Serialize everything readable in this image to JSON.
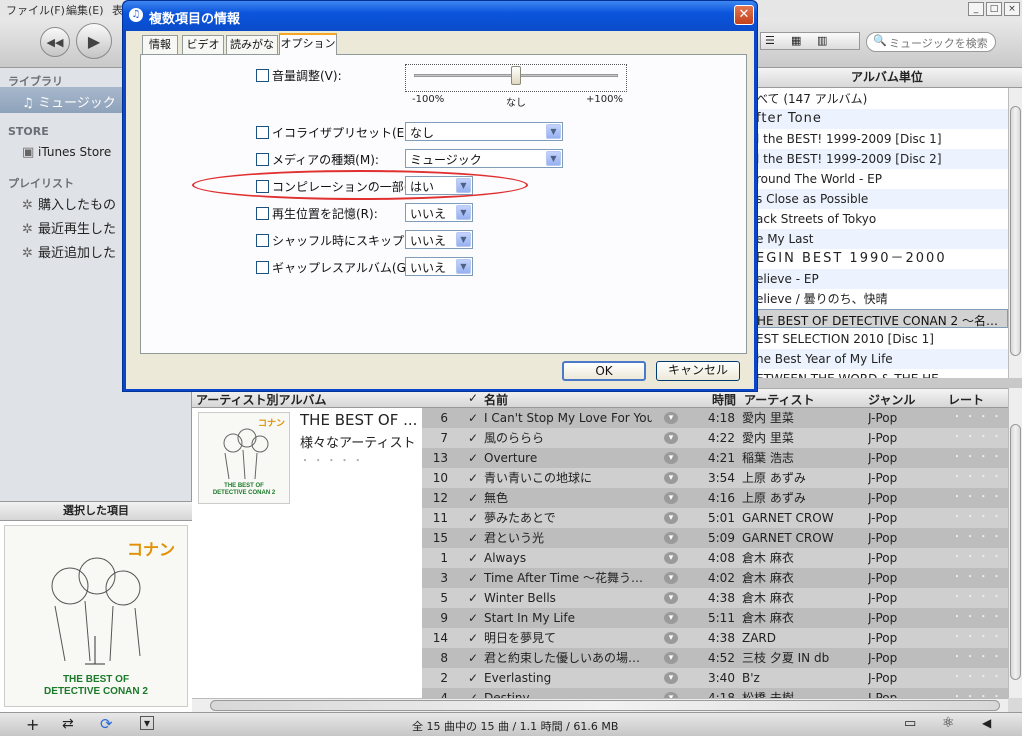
{
  "menu": {
    "file": "ファイル(F)",
    "edit": "編集(E)",
    "more": "表"
  },
  "search": {
    "placeholder": "ミュージックを検索"
  },
  "sidebar": {
    "library_header": "ライブラリ",
    "music": "ミュージック",
    "store_header": "STORE",
    "itunes_store": "iTunes Store",
    "playlist_header": "プレイリスト",
    "playlists": [
      "購入したもの",
      "最近再生した",
      "最近追加した"
    ],
    "selected_header": "選択した項目"
  },
  "cover": {
    "logo": "コナン",
    "line1": "THE BEST OF",
    "line2": "DETECTIVE CONAN 2"
  },
  "album_pane": {
    "header": "アルバム単位",
    "items": [
      "べて (147 アルバム)",
      "fter  Tone",
      "l the BEST! 1999-2009 [Disc 1]",
      "l the BEST! 1999-2009 [Disc 2]",
      "round The World - EP",
      "s Close as Possible",
      "ack Streets of Tokyo",
      "e My Last",
      "EGIN  BEST  1990－2000",
      "elieve - EP",
      "elieve / 曇りのち、快晴",
      "HE BEST OF DETECTIVE CONAN 2 ～名…",
      "EST SELECTION 2010 [Disc 1]",
      "he Best Year of My Life",
      "ETWEEN THE WORD & THE HE"
    ]
  },
  "list": {
    "headers": {
      "artist_album": "アーティスト別アルバム",
      "check": "✓",
      "name": "名前",
      "time": "時間",
      "artist": "アーティスト",
      "genre": "ジャンル",
      "rating": "レート"
    },
    "album_title": "THE BEST OF ...",
    "album_artist": "様々なアーティスト",
    "album_rating": "・ ・ ・ ・ ・",
    "rows": [
      {
        "num": "6",
        "name": "I Can't Stop My Love For You",
        "time": "4:18",
        "artist": "愛内 里菜",
        "genre": "J-Pop",
        "rating": "・ ・ ・ ・ ・"
      },
      {
        "num": "7",
        "name": "風のららら",
        "time": "4:22",
        "artist": "愛内 里菜",
        "genre": "J-Pop",
        "rating": "・ ・ ・ ・ ・"
      },
      {
        "num": "13",
        "name": "Overture",
        "time": "4:21",
        "artist": "稲葉 浩志",
        "genre": "J-Pop",
        "rating": "・ ・ ・ ・ ・"
      },
      {
        "num": "10",
        "name": "青い青いこの地球に",
        "time": "3:54",
        "artist": "上原 あずみ",
        "genre": "J-Pop",
        "rating": "・ ・ ・ ・ ・"
      },
      {
        "num": "12",
        "name": "無色",
        "time": "4:16",
        "artist": "上原 あずみ",
        "genre": "J-Pop",
        "rating": "・ ・ ・ ・ ・"
      },
      {
        "num": "11",
        "name": "夢みたあとで",
        "time": "5:01",
        "artist": "GARNET CROW",
        "genre": "J-Pop",
        "rating": "・ ・ ・ ・ ・"
      },
      {
        "num": "15",
        "name": "君という光",
        "time": "5:09",
        "artist": "GARNET CROW",
        "genre": "J-Pop",
        "rating": "・ ・ ・ ・ ・"
      },
      {
        "num": "1",
        "name": "Always",
        "time": "4:08",
        "artist": "倉木 麻衣",
        "genre": "J-Pop",
        "rating": "・ ・ ・ ・ ・"
      },
      {
        "num": "3",
        "name": "Time After Time ～花舞う…",
        "time": "4:02",
        "artist": "倉木 麻衣",
        "genre": "J-Pop",
        "rating": "・ ・ ・ ・ ・"
      },
      {
        "num": "5",
        "name": "Winter Bells",
        "time": "4:38",
        "artist": "倉木 麻衣",
        "genre": "J-Pop",
        "rating": "・ ・ ・ ・ ・"
      },
      {
        "num": "9",
        "name": "Start In My Life",
        "time": "5:11",
        "artist": "倉木 麻衣",
        "genre": "J-Pop",
        "rating": "・ ・ ・ ・ ・"
      },
      {
        "num": "14",
        "name": "明日を夢見て",
        "time": "4:38",
        "artist": "ZARD",
        "genre": "J-Pop",
        "rating": "・ ・ ・ ・ ・"
      },
      {
        "num": "8",
        "name": "君と約束した優しいあの場…",
        "time": "4:52",
        "artist": "三枝 夕夏 IN db",
        "genre": "J-Pop",
        "rating": "・ ・ ・ ・ ・"
      },
      {
        "num": "2",
        "name": "Everlasting",
        "time": "3:40",
        "artist": "B'z",
        "genre": "J-Pop",
        "rating": "・ ・ ・ ・ ・"
      },
      {
        "num": "4",
        "name": "Destiny",
        "time": "4:18",
        "artist": "松橋 未樹",
        "genre": "J-Pop",
        "rating": "・ ・ ・ ・ ・"
      }
    ]
  },
  "status": "全 15 曲中の 15 曲 / 1.1 時間 / 61.6 MB",
  "dialog": {
    "title": "複数項目の情報",
    "tabs": [
      "情報",
      "ビデオ",
      "読みがな",
      "オプション"
    ],
    "volume_label": "音量調整(V):",
    "volume_min": "-100%",
    "volume_mid": "なし",
    "volume_max": "+100%",
    "volume_value": 0,
    "eq_label": "イコライザプリセット(E):",
    "eq_value": "なし",
    "media_label": "メディアの種類(M):",
    "media_value": "ミュージック",
    "compilation_label": "コンピレーションの一部(P):",
    "compilation_value": "はい",
    "remember_label": "再生位置を記憶(R):",
    "remember_value": "いいえ",
    "shuffle_label": "シャッフル時にスキップ(S):",
    "shuffle_value": "いいえ",
    "gapless_label": "ギャップレスアルバム(G):",
    "gapless_value": "いいえ",
    "ok": "OK",
    "cancel": "キャンセル"
  },
  "colors": {
    "dialog_title": "#0a4bc9",
    "highlight": "#e03030",
    "tab_accent": "#f5a623"
  }
}
